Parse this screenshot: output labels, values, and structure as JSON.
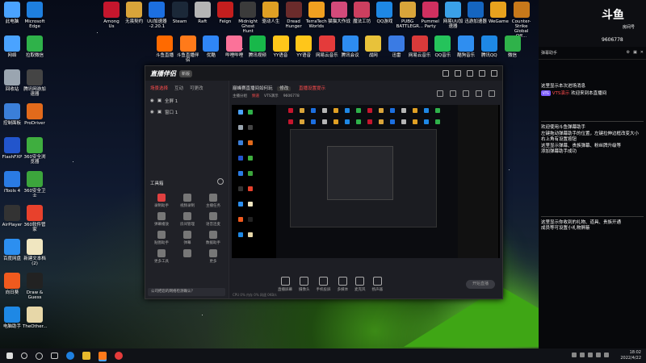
{
  "desktop": {
    "left_icons": [
      {
        "label": "此电脑",
        "color": "#4aa3ff"
      },
      {
        "label": "Microsoft Edge",
        "color": "#1e7fe0"
      },
      {
        "label": "网络",
        "color": "#4aa3ff"
      },
      {
        "label": "拉取微信",
        "color": "#2fb24a"
      },
      {
        "label": "回收站",
        "color": "#9aa5b0"
      },
      {
        "label": "腾讯网游加速器",
        "color": "#444"
      },
      {
        "label": "控制面板",
        "color": "#3b7fd9"
      },
      {
        "label": "ProDriver",
        "color": "#e26a1b"
      },
      {
        "label": "FlashFXP",
        "color": "#2255cc"
      },
      {
        "label": "360安全浏览器",
        "color": "#3fae3f"
      },
      {
        "label": "iTools 4",
        "color": "#2a7be4"
      },
      {
        "label": "360安全卫士",
        "color": "#3ca53c"
      },
      {
        "label": "AirPlayer",
        "color": "#333"
      },
      {
        "label": "360软件管家",
        "color": "#e8412c"
      },
      {
        "label": "百度网盘",
        "color": "#2c8ff0"
      },
      {
        "label": "新建文本档(2)",
        "color": "#f0e6c0"
      },
      {
        "label": "向日葵",
        "color": "#f05a1e"
      },
      {
        "label": "Draw & Guess",
        "color": "#222"
      },
      {
        "label": "电脑助手",
        "color": "#1e88e5"
      },
      {
        "label": "TheOther...",
        "color": "#e7d7a8"
      }
    ],
    "top_icons": [
      {
        "label": "Among Us",
        "color": "#c5162d"
      },
      {
        "label": "无畏契约",
        "color": "#d9a43a"
      },
      {
        "label": "UU加速器 -2.20.1",
        "color": "#1c6fe0"
      },
      {
        "label": "Steam",
        "color": "#1b2838"
      },
      {
        "label": "Raft",
        "color": "#b5b5b5"
      },
      {
        "label": "Feign",
        "color": "#c41e1e"
      },
      {
        "label": "Midnight Ghost Hunt",
        "color": "#3b3b3b"
      },
      {
        "label": "驱动人生",
        "color": "#e0a024"
      },
      {
        "label": "Dread Hunger",
        "color": "#6b2b2b"
      },
      {
        "label": "TerraTech Worlds",
        "color": "#f0a020"
      },
      {
        "label": "猫猫大作战",
        "color": "#d34a7a"
      },
      {
        "label": "魔法工坊",
        "color": "#cc3f5f"
      },
      {
        "label": "QQ游戏",
        "color": "#1e88e5"
      },
      {
        "label": "PUBG BATTLEGR...",
        "color": "#d9a43a"
      },
      {
        "label": "Pummel Party",
        "color": "#d03060"
      },
      {
        "label": "网易UU加速器",
        "color": "#3aa0e8"
      },
      {
        "label": "迅游加速器",
        "color": "#1565c0"
      },
      {
        "label": "WeGame",
        "color": "#e8a21e"
      },
      {
        "label": "Counter-Strike Global Off...",
        "color": "#c7781a"
      }
    ],
    "row2_icons": [
      {
        "label": "斗鱼直播",
        "color": "#ff6a00"
      },
      {
        "label": "斗鱼直播伴侣",
        "color": "#ff7a1a"
      },
      {
        "label": "优酷",
        "color": "#2f86f6"
      },
      {
        "label": "哔哩哔哩",
        "color": "#fb7299"
      },
      {
        "label": "腾讯视频",
        "color": "#18b84a"
      },
      {
        "label": "YY语音",
        "color": "#ffc61a"
      },
      {
        "label": "YY语音",
        "color": "#ffc61a"
      },
      {
        "label": "网易云音乐",
        "color": "#e43b3b"
      },
      {
        "label": "腾讯会议",
        "color": "#2d8cf0"
      },
      {
        "label": "战网",
        "color": "#e8c23a"
      },
      {
        "label": "迅雷",
        "color": "#3a7be4"
      },
      {
        "label": "网易云音乐",
        "color": "#d93a3a"
      },
      {
        "label": "QQ音乐",
        "color": "#25c35b"
      },
      {
        "label": "酷狗音乐",
        "color": "#2f8ef0"
      },
      {
        "label": "腾讯QQ",
        "color": "#1e88e5"
      },
      {
        "label": "微信",
        "color": "#2fb24a"
      }
    ]
  },
  "app": {
    "logo": "直播伴侣",
    "version": "新版",
    "left_tabs": [
      "场景选择",
      "互动",
      "可更改"
    ],
    "active_left_tab": "场景选择",
    "scenes": [
      "全屏 1",
      "窗口 1"
    ],
    "tools_header": "工具箱",
    "tools": [
      "录制助手",
      "视频录制",
      "主播任务",
      "弹幕播放",
      "房间管理",
      "语音连麦",
      "贴图助手",
      "弹幕",
      "数据助手",
      "更多工具",
      "",
      "更多"
    ],
    "notice": "公司把您的网络检测确认？",
    "stream_title": "巅峰赛直播间如何玩",
    "stream_tag": "修改",
    "stream_tag2": "直播设置提示",
    "meta_items": [
      "主播分组",
      "频道",
      "VTS演示",
      "9606778"
    ],
    "toolbar": [
      "直播屏幕",
      "摄像头",
      "手机投屏",
      "多媒体",
      "麦克风",
      "扬声器"
    ],
    "start_button": "开始直播",
    "status_text": "CPU 0%  内存 0%  网速 0KB/s"
  },
  "chat": {
    "brand": "斗鱼",
    "brand_sub": "房间号",
    "room_id": "9606778",
    "tabs": [
      "弹幕助手",
      "",
      "",
      ""
    ],
    "messages_top": [
      {
        "text": "这里显示本次进场消息",
        "color": "#ffffff"
      },
      {
        "badge": "VTS",
        "name": "VTS演示",
        "text": "欢迎来到本直播间"
      }
    ],
    "messages_mid": [
      "欢迎使用斗鱼弹幕助手",
      "左键拖动弹幕助手的位置，左键拉伸边框改变大小",
      "右上角有设置按钮",
      "这里显示弹幕、贵族弹幕、粉丝牌升级等",
      "添加弹幕助手成功"
    ],
    "messages_bottom": [
      "这里显示你收到的礼物、道具、贵族开通",
      "成员等可设置小礼物屏蔽"
    ]
  },
  "taskbar": {
    "time": "18:02",
    "date": "2022/4/22"
  }
}
